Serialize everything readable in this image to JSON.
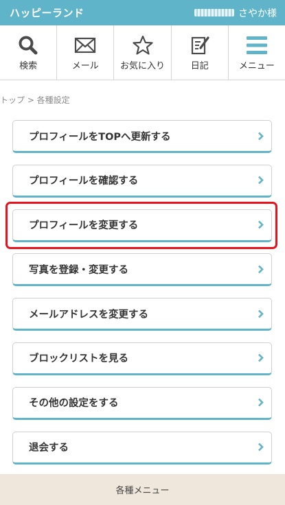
{
  "header": {
    "logo": "ハッピーランド",
    "user_name": "さやか様"
  },
  "nav": {
    "items": [
      {
        "label": "検索",
        "icon": "search-icon"
      },
      {
        "label": "メール",
        "icon": "mail-icon"
      },
      {
        "label": "お気に入り",
        "icon": "star-icon"
      },
      {
        "label": "日記",
        "icon": "diary-icon"
      },
      {
        "label": "メニュー",
        "icon": "hamburger-menu-icon"
      }
    ]
  },
  "breadcrumb": "トップ > 各種設定",
  "menu": {
    "items": [
      {
        "label": "プロフィールをTOPへ更新する"
      },
      {
        "label": "プロフィールを確認する"
      },
      {
        "label": "プロフィールを変更する"
      },
      {
        "label": "写真を登録・変更する"
      },
      {
        "label": "メールアドレスを変更する"
      },
      {
        "label": "ブロックリストを見る"
      },
      {
        "label": "その他の設定をする"
      },
      {
        "label": "退会する"
      }
    ]
  },
  "footer": {
    "label": "各種メニュー"
  },
  "colors": {
    "accent": "#5fb4c9",
    "highlight": "#e8121d",
    "footer_bg": "#f0e7dc"
  }
}
